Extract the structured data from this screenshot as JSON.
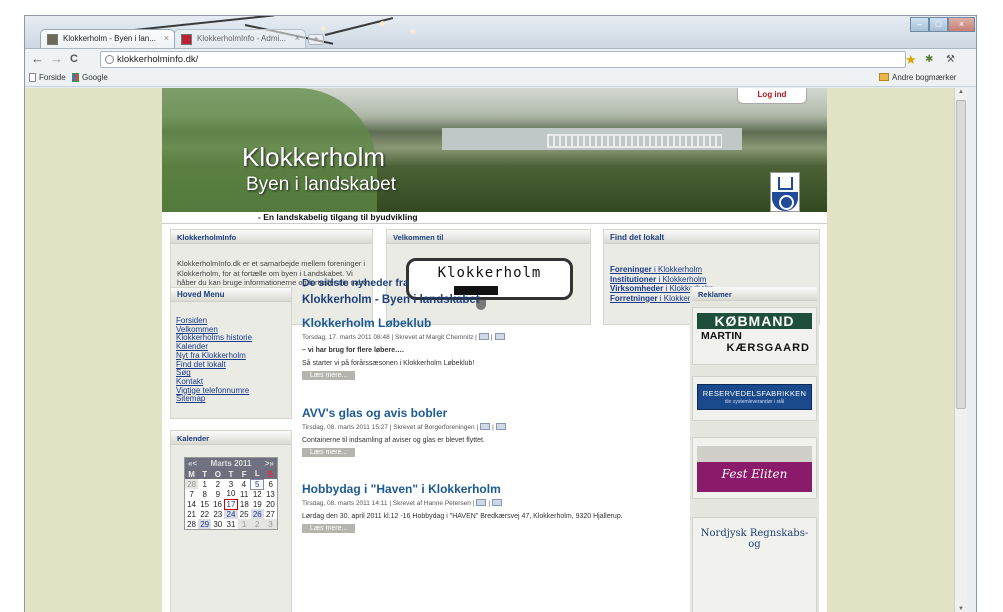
{
  "browser": {
    "tabs": [
      {
        "label": "Klokkerholm - Byen i lan...",
        "active": true
      },
      {
        "label": "KlokkerholmInfo - Admi...",
        "active": false
      }
    ],
    "new_tab_glyph": "+",
    "window_controls": {
      "minimize": "–",
      "maximize": "□",
      "close": "×"
    },
    "nav": {
      "back": "←",
      "forward": "→",
      "reload": "C"
    },
    "url": "klokkerholminfo.dk/",
    "bookmark_star": "★",
    "bookmarks": [
      {
        "label": "Forside",
        "icon": "page-icon"
      },
      {
        "label": "Google",
        "icon": "google-icon"
      }
    ],
    "other_bookmarks": "Andre bogmærker"
  },
  "site": {
    "login": "Log ind",
    "banner_title": "Klokkerholm",
    "banner_subtitle": "Byen i landskabet",
    "tagline": "- En landskabelig tilgang til byudvikling",
    "info_box": {
      "title": "KlokkerholmInfo",
      "text": "KlokkerholmInfo.dk er et samarbejde mellem foreninger i Klokkerholm, for at fortælle om byen i Landskabet. Vi håber du kan bruge informationerne og fortæller din nabo og andre om hjemmesiden."
    },
    "welcome_box": {
      "title": "Velkommen til",
      "sign_text": "Klokkerholm"
    },
    "find_box": {
      "title": "Find det lokalt",
      "links": [
        {
          "bold": "Foreninger",
          "rest": " i Klokkerholm"
        },
        {
          "bold": "Institutioner",
          "rest": " i Klokkerholm"
        },
        {
          "bold": "Virksomheder",
          "rest": " i Klokkerholm"
        },
        {
          "bold": "Forretninger",
          "rest": " i Klokkerholm"
        }
      ]
    },
    "menu": {
      "title": "Hoved Menu",
      "items": [
        "Forsiden",
        "Velkommen",
        "Klokkerholms historie",
        "Kalender",
        "Nyt fra Klokkerholm",
        "Find det lokalt",
        "Søg",
        "Kontakt",
        "Vigtige telefonnumre",
        "Sitemap"
      ]
    },
    "calendar": {
      "title": "Kalender",
      "prev": "«<",
      "next": ">»",
      "month": "Marts 2011",
      "weekdays": [
        "M",
        "T",
        "O",
        "T",
        "F",
        "L",
        "S"
      ],
      "rows": [
        [
          "28",
          "1",
          "2",
          "3",
          "4",
          "5",
          "6"
        ],
        [
          "7",
          "8",
          "9",
          "10",
          "11",
          "12",
          "13"
        ],
        [
          "14",
          "15",
          "16",
          "17",
          "18",
          "19",
          "20"
        ],
        [
          "21",
          "22",
          "23",
          "24",
          "25",
          "26",
          "27"
        ],
        [
          "28",
          "29",
          "30",
          "31",
          "1",
          "2",
          "3"
        ]
      ]
    },
    "news": {
      "heading_line1": "De sidste nyheder fra",
      "heading_line2": "Klokkerholm - Byen i landskabet",
      "articles": [
        {
          "title": "Klokkerholm Løbeklub",
          "meta": "Torsdag, 17. marts 2011 08:48 | Skrevet af Margit Chemnitz |",
          "bold_line": "– vi har brug for flere løbere….",
          "text": "Så starter vi på forårssæsonen i Klokkerholm Løbeklub!",
          "read_more": "Læs mere..."
        },
        {
          "title": "AVV's glas og avis bobler",
          "meta": "Tirsdag, 08. marts 2011 15:27 | Skrevet af Borgerforeningen |",
          "text": "Containerne til indsamling af aviser og glas er blevet flyttet.",
          "read_more": "Læs mere..."
        },
        {
          "title": "Hobbydag i \"Haven\" i Klokkerholm",
          "meta": "Tirsdag, 08. marts 2011 14:11 | Skrevet af Hanne Petersen |",
          "text": "Lørdag den 30. april 2011 kl.12 -16 Hobbydag i \"HAVEN\" Bredkærsvej 47, Klokkerholm, 9320 Hjallerup.",
          "read_more": "Læs mere..."
        }
      ]
    },
    "ads": {
      "title": "Reklamer",
      "items": [
        {
          "line1": "KØBMAND",
          "line2": "MARTIN",
          "line3": "KÆRSGAARD"
        },
        {
          "line1": "RESERVEDELSFABRIKKEN",
          "line2": "din systemleverandør i stål"
        },
        {
          "line1": "Fest Eliten"
        },
        {
          "line1": "Nordjysk Regnskabs- og"
        }
      ]
    }
  },
  "colors": {
    "accent": "#1c3f7c",
    "page_bg": "#e2e2c4",
    "login_red": "#b4141d",
    "ad_red": "#b4141d",
    "ad_green": "#1e4f3a",
    "ad_blue": "#1b4a8c",
    "ad_purple": "#8a1a6a"
  }
}
